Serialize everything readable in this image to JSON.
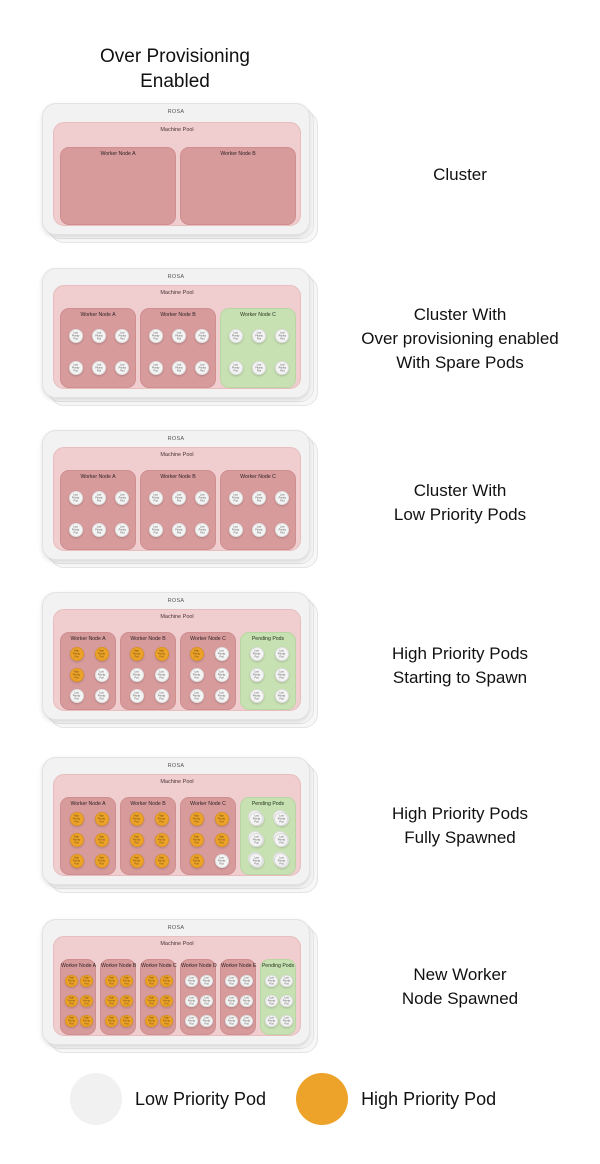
{
  "title": "Over Provisioning\nEnabled",
  "labels": {
    "rosa": "ROSA",
    "machine_pool": "Machine Pool",
    "pod_text": "Low\nPriority\nPod",
    "pod_text_high": "High\nPriority\nPod"
  },
  "legend": {
    "low": {
      "label": "Low Priority Pod",
      "color": "#f1f1f1"
    },
    "high": {
      "label": "High Priority Pod",
      "color": "#eda32a"
    }
  },
  "colors": {
    "rosa_bg": "#f2f2f2",
    "machine_pool_bg": "#f0cdce",
    "worker_node_bg": "#d89b9c",
    "pending_node_bg": "#c8e1b3",
    "low_priority_pod": "#f4f4f4",
    "high_priority_pod": "#eda32a"
  },
  "rows": [
    {
      "caption": "Cluster",
      "nodes": [
        {
          "label": "Worker Node A",
          "kind": "worker",
          "pods": []
        },
        {
          "label": "Worker Node B",
          "kind": "worker",
          "pods": []
        }
      ]
    },
    {
      "caption": "Cluster With\nOver provisioning enabled\nWith Spare Pods",
      "nodes": [
        {
          "label": "Worker Node A",
          "kind": "worker",
          "pods": [
            "low",
            "low",
            "low",
            "low",
            "low",
            "low"
          ]
        },
        {
          "label": "Worker Node B",
          "kind": "worker",
          "pods": [
            "low",
            "low",
            "low",
            "low",
            "low",
            "low"
          ]
        },
        {
          "label": "Worker Node C",
          "kind": "spare",
          "pods": [
            "low",
            "low",
            "low",
            "low",
            "low",
            "low"
          ]
        }
      ]
    },
    {
      "caption": "Cluster With\nLow Priority Pods",
      "nodes": [
        {
          "label": "Worker Node A",
          "kind": "worker",
          "pods": [
            "low",
            "low",
            "low",
            "low",
            "low",
            "low"
          ]
        },
        {
          "label": "Worker Node B",
          "kind": "worker",
          "pods": [
            "low",
            "low",
            "low",
            "low",
            "low",
            "low"
          ]
        },
        {
          "label": "Worker Node C",
          "kind": "worker",
          "pods": [
            "low",
            "low",
            "low",
            "low",
            "low",
            "low"
          ]
        }
      ]
    },
    {
      "caption": "High Priority Pods\nStarting to Spawn",
      "nodes": [
        {
          "label": "Worker Node A",
          "kind": "worker",
          "pods": [
            "high",
            "high",
            "high",
            "low",
            "low",
            "low"
          ]
        },
        {
          "label": "Worker Node B",
          "kind": "worker",
          "pods": [
            "high",
            "high",
            "low",
            "low",
            "low",
            "low"
          ]
        },
        {
          "label": "Worker Node C",
          "kind": "worker",
          "pods": [
            "high",
            "low",
            "low",
            "low",
            "low",
            "low"
          ]
        },
        {
          "label": "Pending Pods",
          "kind": "pending",
          "pods": [
            "low",
            "low",
            "low",
            "low",
            "low",
            "low"
          ]
        }
      ]
    },
    {
      "caption": "High Priority Pods\nFully Spawned",
      "nodes": [
        {
          "label": "Worker Node A",
          "kind": "worker",
          "pods": [
            "high",
            "high",
            "high",
            "high",
            "high",
            "high"
          ]
        },
        {
          "label": "Worker Node B",
          "kind": "worker",
          "pods": [
            "high",
            "high",
            "high",
            "high",
            "high",
            "high"
          ]
        },
        {
          "label": "Worker Node C",
          "kind": "worker",
          "pods": [
            "high",
            "high",
            "high",
            "high",
            "high",
            "low"
          ]
        },
        {
          "label": "Pending Pods",
          "kind": "pending",
          "pods": [
            "stack",
            "stack",
            "stack",
            "stack",
            "stack",
            "stack"
          ]
        }
      ]
    },
    {
      "caption": "New Worker\nNode Spawned",
      "nodes": [
        {
          "label": "Worker Node A",
          "kind": "worker",
          "pods": [
            "high",
            "high",
            "high",
            "high",
            "high",
            "high"
          ]
        },
        {
          "label": "Worker Node B",
          "kind": "worker",
          "pods": [
            "high",
            "high",
            "high",
            "high",
            "high",
            "high"
          ]
        },
        {
          "label": "Worker Node C",
          "kind": "worker",
          "pods": [
            "high",
            "high",
            "high",
            "high",
            "high",
            "high"
          ]
        },
        {
          "label": "Worker Node D",
          "kind": "worker",
          "pods": [
            "low",
            "low",
            "low",
            "low",
            "low",
            "low"
          ]
        },
        {
          "label": "Worker Node E",
          "kind": "worker",
          "pods": [
            "low",
            "low",
            "low",
            "low",
            "low",
            "low"
          ]
        },
        {
          "label": "Pending Pods",
          "kind": "pending",
          "pods": [
            "low",
            "low",
            "low",
            "low",
            "low",
            "low"
          ]
        }
      ]
    }
  ]
}
